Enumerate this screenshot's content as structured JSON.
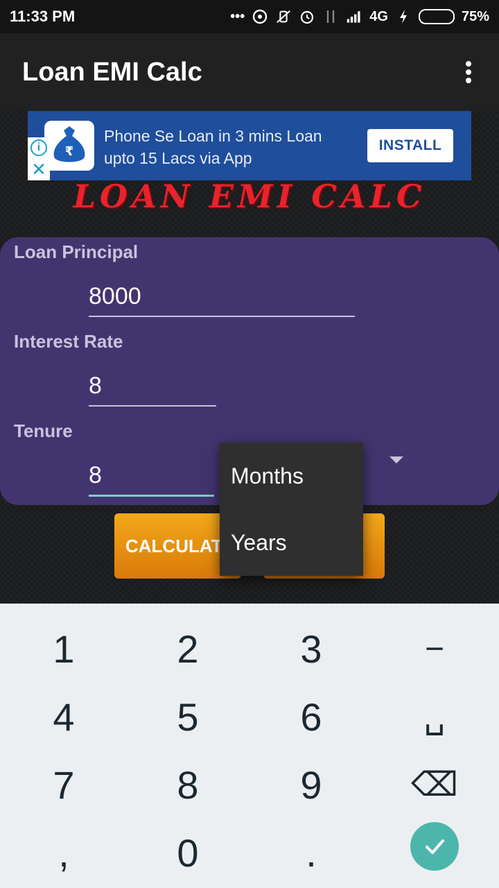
{
  "status_bar": {
    "time": "11:33 PM",
    "network": "4G",
    "battery": "75%",
    "battery_level": 0.75
  },
  "app_bar": {
    "title": "Loan EMI Calc"
  },
  "ad": {
    "text_line1": "Phone Se Loan in 3 mins Loan",
    "text_line2": "upto 15 Lacs via App",
    "install_label": "INSTALL"
  },
  "brand": {
    "text": "LOAN EMI CALC"
  },
  "form": {
    "principal_label": "Loan Principal",
    "principal_value": "8000",
    "rate_label": "Interest Rate",
    "rate_value": "8",
    "tenure_label": "Tenure",
    "tenure_value": "8"
  },
  "buttons": {
    "calculate_label": "CALCULATE",
    "second_label": ""
  },
  "dropdown": {
    "options": [
      "Months",
      "Years"
    ]
  },
  "keyboard": {
    "keys": [
      "1",
      "2",
      "3",
      "−",
      "4",
      "5",
      "6",
      "␣",
      "7",
      "8",
      "9",
      "⌫",
      ",",
      "0",
      "."
    ]
  }
}
